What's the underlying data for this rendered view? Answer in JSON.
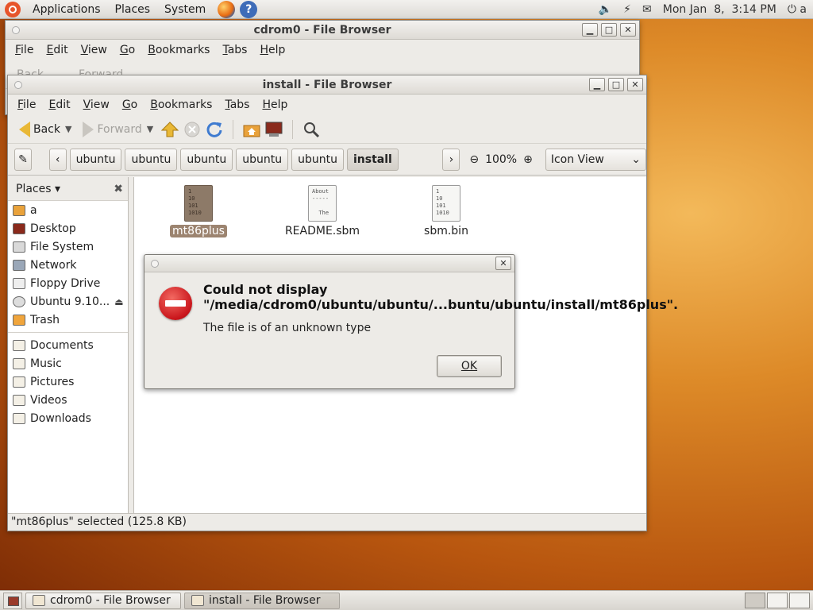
{
  "top_panel": {
    "menus": [
      "Applications",
      "Places",
      "System"
    ],
    "clock": "Mon Jan  8,  3:14 PM",
    "user": "a"
  },
  "back_window": {
    "title": "cdrom0 - File Browser",
    "menus": [
      "File",
      "Edit",
      "View",
      "Go",
      "Bookmarks",
      "Tabs",
      "Help"
    ],
    "toolbar": {
      "back": "Back",
      "forward": "Forward"
    }
  },
  "front_window": {
    "title": "install - File Browser",
    "menus": [
      "File",
      "Edit",
      "View",
      "Go",
      "Bookmarks",
      "Tabs",
      "Help"
    ],
    "toolbar": {
      "back": "Back",
      "forward": "Forward"
    },
    "breadcrumb": [
      "ubuntu",
      "ubuntu",
      "ubuntu",
      "ubuntu",
      "ubuntu",
      "install"
    ],
    "zoom": "100%",
    "view_mode": "Icon View",
    "sidebar_title": "Places",
    "sidebar_places": [
      "a",
      "Desktop",
      "File System",
      "Network",
      "Floppy Drive",
      "Ubuntu 9.10...",
      "Trash"
    ],
    "sidebar_bookmarks": [
      "Documents",
      "Music",
      "Pictures",
      "Videos",
      "Downloads"
    ],
    "files": [
      {
        "name": "mt86plus",
        "icon_text": "1\n10\n101\n1010",
        "selected": true
      },
      {
        "name": "README.sbm",
        "icon_text": "About\n-----\n\n  The",
        "selected": false
      },
      {
        "name": "sbm.bin",
        "icon_text": "1\n10\n101\n1010",
        "selected": false
      }
    ],
    "status": "\"mt86plus\" selected (125.8 KB)"
  },
  "dialog": {
    "title": "Could not display \"/media/cdrom0/ubuntu/ubuntu/...buntu/ubuntu/install/mt86plus\".",
    "message": "The file is of an unknown type",
    "ok": "OK"
  },
  "taskbar": {
    "items": [
      "cdrom0 - File Browser",
      "install - File Browser"
    ]
  },
  "colors": {
    "error_red": "#c9151b",
    "selection": "#9c8470",
    "desktop": "#dd8a28"
  }
}
